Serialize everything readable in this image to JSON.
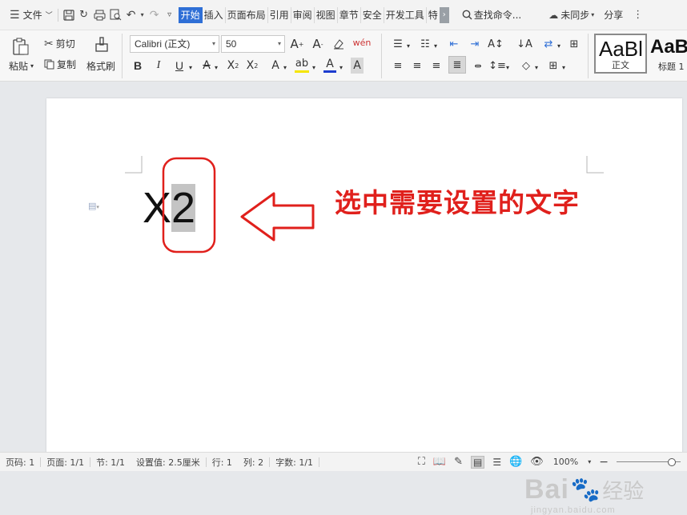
{
  "menubar": {
    "file_label": "文件",
    "tabs": [
      {
        "label": "开始",
        "active": true
      },
      {
        "label": "插入",
        "active": false
      },
      {
        "label": "页面布局",
        "active": false
      },
      {
        "label": "引用",
        "active": false
      },
      {
        "label": "审阅",
        "active": false
      },
      {
        "label": "视图",
        "active": false
      },
      {
        "label": "章节",
        "active": false
      },
      {
        "label": "安全",
        "active": false
      },
      {
        "label": "开发工具",
        "active": false
      },
      {
        "label": "特",
        "active": false
      }
    ],
    "search_placeholder": "查找命令...",
    "sync_label": "未同步",
    "share_label": "分享"
  },
  "toolbar": {
    "paste_label": "粘贴",
    "cut_label": "剪切",
    "copy_label": "复制",
    "format_painter_label": "格式刷",
    "font_name": "Calibri (正文)",
    "font_size": "50",
    "bold": "B",
    "italic": "I",
    "underline": "U",
    "styles": [
      {
        "preview": "AaBl",
        "label": "正文"
      },
      {
        "preview": "AaB",
        "label": "标题 1"
      }
    ]
  },
  "document": {
    "text_before": "X",
    "selected_text": "2",
    "annotation": "选中需要设置的文字",
    "accent_color": "#e0201c"
  },
  "statusbar": {
    "page_no": "页码: 1",
    "pages": "页面: 1/1",
    "section": "节: 1/1",
    "setting": "设置值: 2.5厘米",
    "line": "行: 1",
    "column": "列: 2",
    "word_count": "字数: 1/1",
    "zoom": "100%"
  },
  "watermark": {
    "brand": "Bai",
    "brand_cn": "经验",
    "url": "jingyan.baidu.com"
  },
  "colors": {
    "active_tab": "#2f6fd6",
    "highlight": "#c4c4c4",
    "annotation_red": "#e0201c"
  }
}
